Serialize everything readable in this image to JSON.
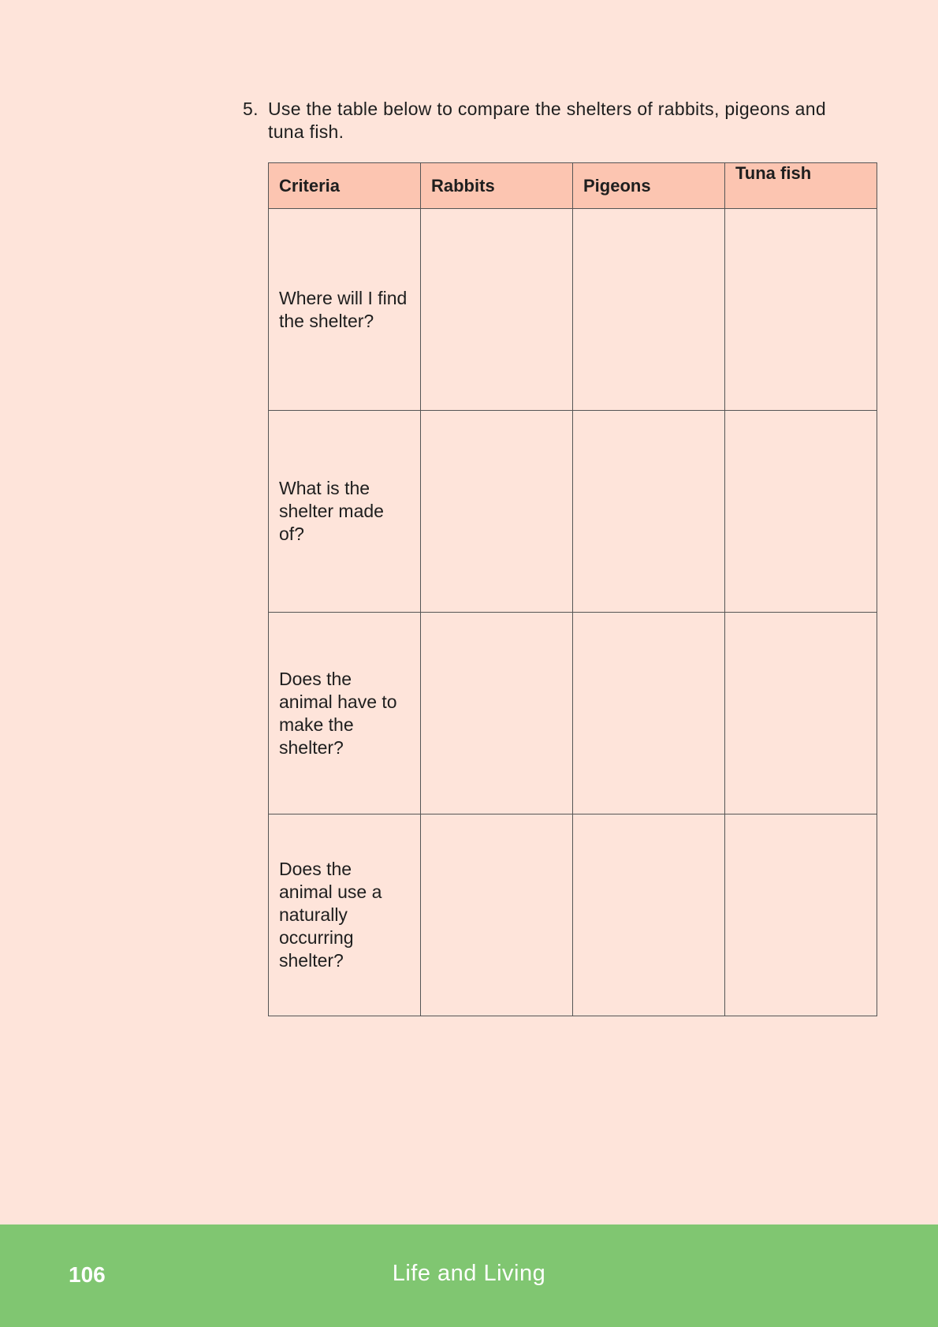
{
  "question": {
    "number": "5.",
    "text": "Use the table below to compare the shelters of rabbits, pigeons and tuna fish."
  },
  "table": {
    "headers": [
      "Criteria",
      "Rabbits",
      "Pigeons",
      "Tuna fish"
    ],
    "rows": [
      {
        "criteria": "Where will I find the shelter?",
        "cells": [
          "",
          "",
          ""
        ]
      },
      {
        "criteria": "What is the shelter made of?",
        "cells": [
          "",
          "",
          ""
        ]
      },
      {
        "criteria": "Does the animal have to make the shelter?",
        "cells": [
          "",
          "",
          ""
        ]
      },
      {
        "criteria": "Does the animal use a naturally occurring shelter?",
        "cells": [
          "",
          "",
          ""
        ]
      }
    ]
  },
  "footer": {
    "page_number": "106",
    "book_title": "Life and Living"
  },
  "colors": {
    "page_background": "#fee4da",
    "header_background": "#fcc5b1",
    "footer_background": "#80c671"
  }
}
